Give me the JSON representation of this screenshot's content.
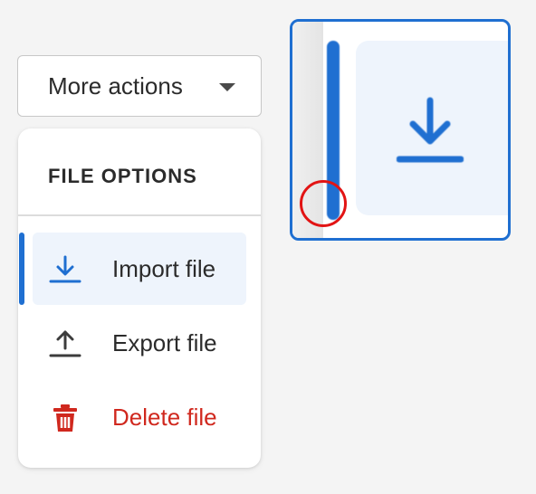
{
  "actions_button": {
    "label": "More actions",
    "caret_icon": "caret-down-icon"
  },
  "menu": {
    "heading": "FILE OPTIONS",
    "items": [
      {
        "label": "Import file",
        "icon": "download-icon",
        "active": true
      },
      {
        "label": "Export file",
        "icon": "upload-icon",
        "active": false
      },
      {
        "label": "Delete file",
        "icon": "trash-icon",
        "danger": true
      }
    ]
  },
  "zoom_inset": {
    "icon": "download-icon"
  },
  "colors": {
    "accent": "#1f6fd1",
    "active_bg": "#eef4fc",
    "danger": "#d0281e",
    "indicator": "#e21414",
    "text": "#2b2b2b"
  }
}
